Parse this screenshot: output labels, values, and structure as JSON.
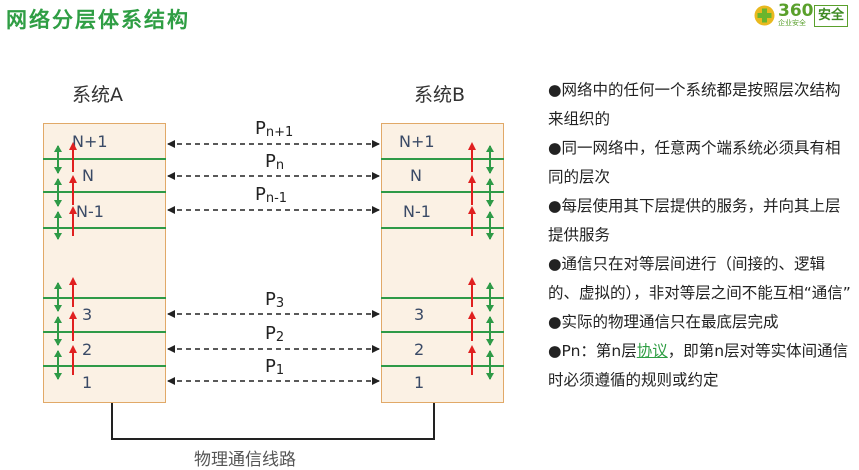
{
  "title": "网络分层体系结构",
  "logo": {
    "number": "360",
    "subtitle": "企业安全",
    "badge": "安全",
    "brand_color": "#5aa02c"
  },
  "diagram": {
    "system_a": "系统A",
    "system_b": "系统B",
    "layers_top": [
      "N+1",
      "N",
      "N-1"
    ],
    "layers_bottom": [
      "3",
      "2",
      "1"
    ],
    "protocols_top": [
      {
        "base": "P",
        "sub": "n+1"
      },
      {
        "base": "P",
        "sub": "n"
      },
      {
        "base": "P",
        "sub": "n-1"
      }
    ],
    "protocols_bottom": [
      {
        "base": "P",
        "sub": "3"
      },
      {
        "base": "P",
        "sub": "2"
      },
      {
        "base": "P",
        "sub": "1"
      }
    ],
    "physical_link": "物理通信线路",
    "colors": {
      "layer_line": "#2e9a47",
      "stack_fill": "#fbf1e4",
      "stack_border": "#e1a968",
      "up_arrow": "#e02020",
      "service_arrow": "#2e9a47"
    }
  },
  "notes": [
    {
      "text": "●网络中的任何一个系统都是按照层次结构来组织的"
    },
    {
      "text": "●同一网络中，任意两个端系统必须具有相同的层次"
    },
    {
      "text": "●每层使用其下层提供的服务，并向其上层提供服务"
    },
    {
      "text": "●通信只在对等层间进行（间接的、逻辑的、虚拟的），非对等层之间不能互相“通信”"
    },
    {
      "text": "●实际的物理通信只在最底层完成"
    },
    {
      "prefix": "●Pn：第n层",
      "link": "协议",
      "suffix": "，即第n层对等实体间通信时必须遵循的规则或约定"
    }
  ]
}
